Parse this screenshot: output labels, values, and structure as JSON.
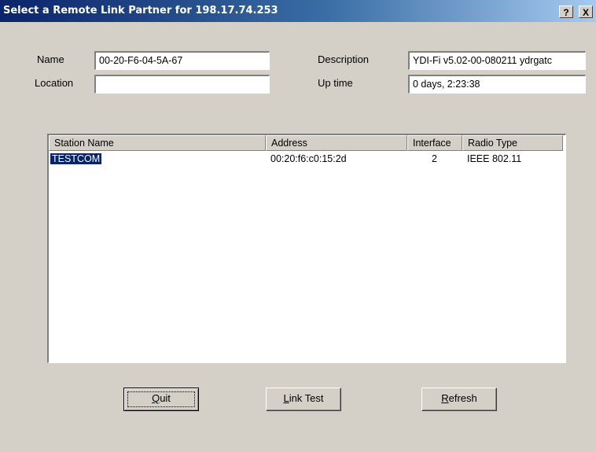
{
  "window": {
    "title": "Select a Remote Link Partner for 198.17.74.253",
    "help_glyph": "?",
    "close_glyph": "X"
  },
  "form": {
    "name_label": "Name",
    "name_value": "00-20-F6-04-5A-67",
    "location_label": "Location",
    "location_value": "",
    "description_label": "Description",
    "description_value": "YDI-Fi  v5.02-00-080211 ydrgatc",
    "uptime_label": "Up time",
    "uptime_value": "0 days, 2:23:38"
  },
  "list": {
    "columns": [
      "Station Name",
      "Address",
      "Interface",
      "Radio Type"
    ],
    "rows": [
      {
        "station_name": "TESTCOM",
        "address": "00:20:f6:c0:15:2d",
        "interface": "2",
        "radio_type": "IEEE 802.11",
        "selected": true
      }
    ]
  },
  "buttons": {
    "quit_mnemonic": "Q",
    "quit_rest": "uit",
    "linktest_mnemonic": "L",
    "linktest_rest": "ink Test",
    "refresh_mnemonic": "R",
    "refresh_rest": "efresh"
  },
  "colors": {
    "titlebar_start": "#0a246a",
    "titlebar_end": "#a6caf0",
    "selection": "#0a246a",
    "dialog_bg": "#d4d0c8"
  }
}
